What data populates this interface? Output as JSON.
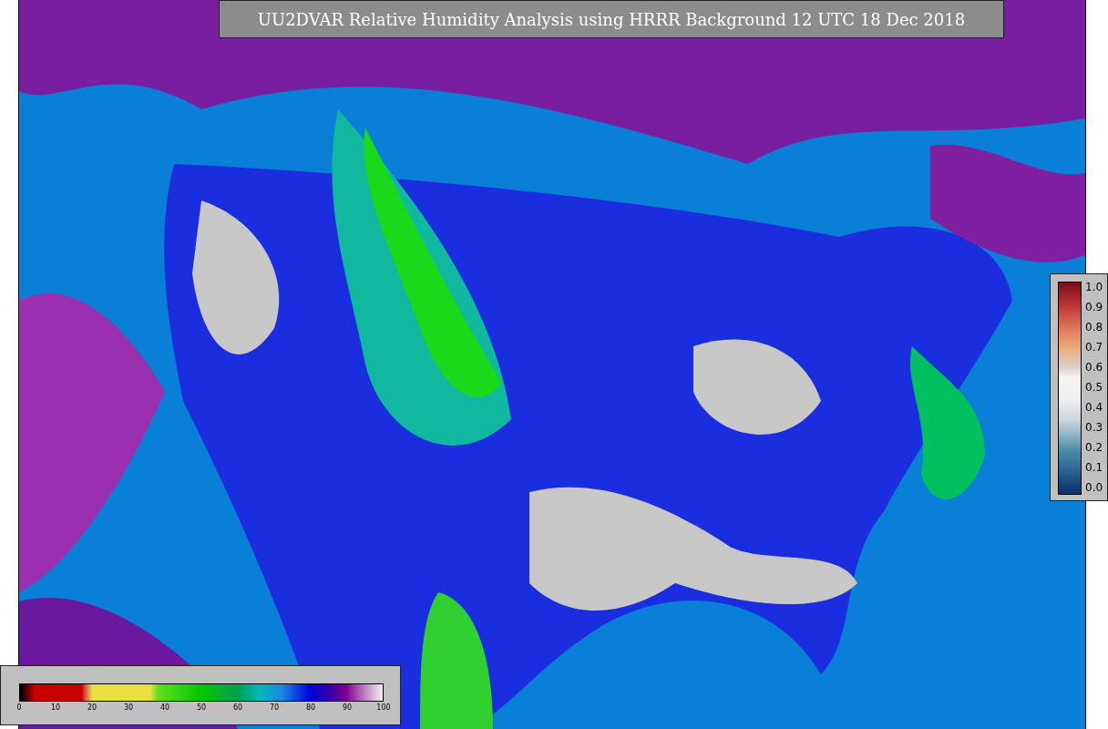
{
  "title": "UU2DVAR Relative Humidity Analysis using HRRR Background 12 UTC 18 Dec 2018",
  "vertical_colorbar": {
    "ticks": [
      "1.0",
      "0.9",
      "0.8",
      "0.7",
      "0.6",
      "0.5",
      "0.4",
      "0.3",
      "0.2",
      "0.1",
      "0.0"
    ]
  },
  "horizontal_colorbar": {
    "ticks": [
      "0",
      "10",
      "20",
      "30",
      "40",
      "50",
      "60",
      "70",
      "80",
      "90",
      "100"
    ]
  }
}
